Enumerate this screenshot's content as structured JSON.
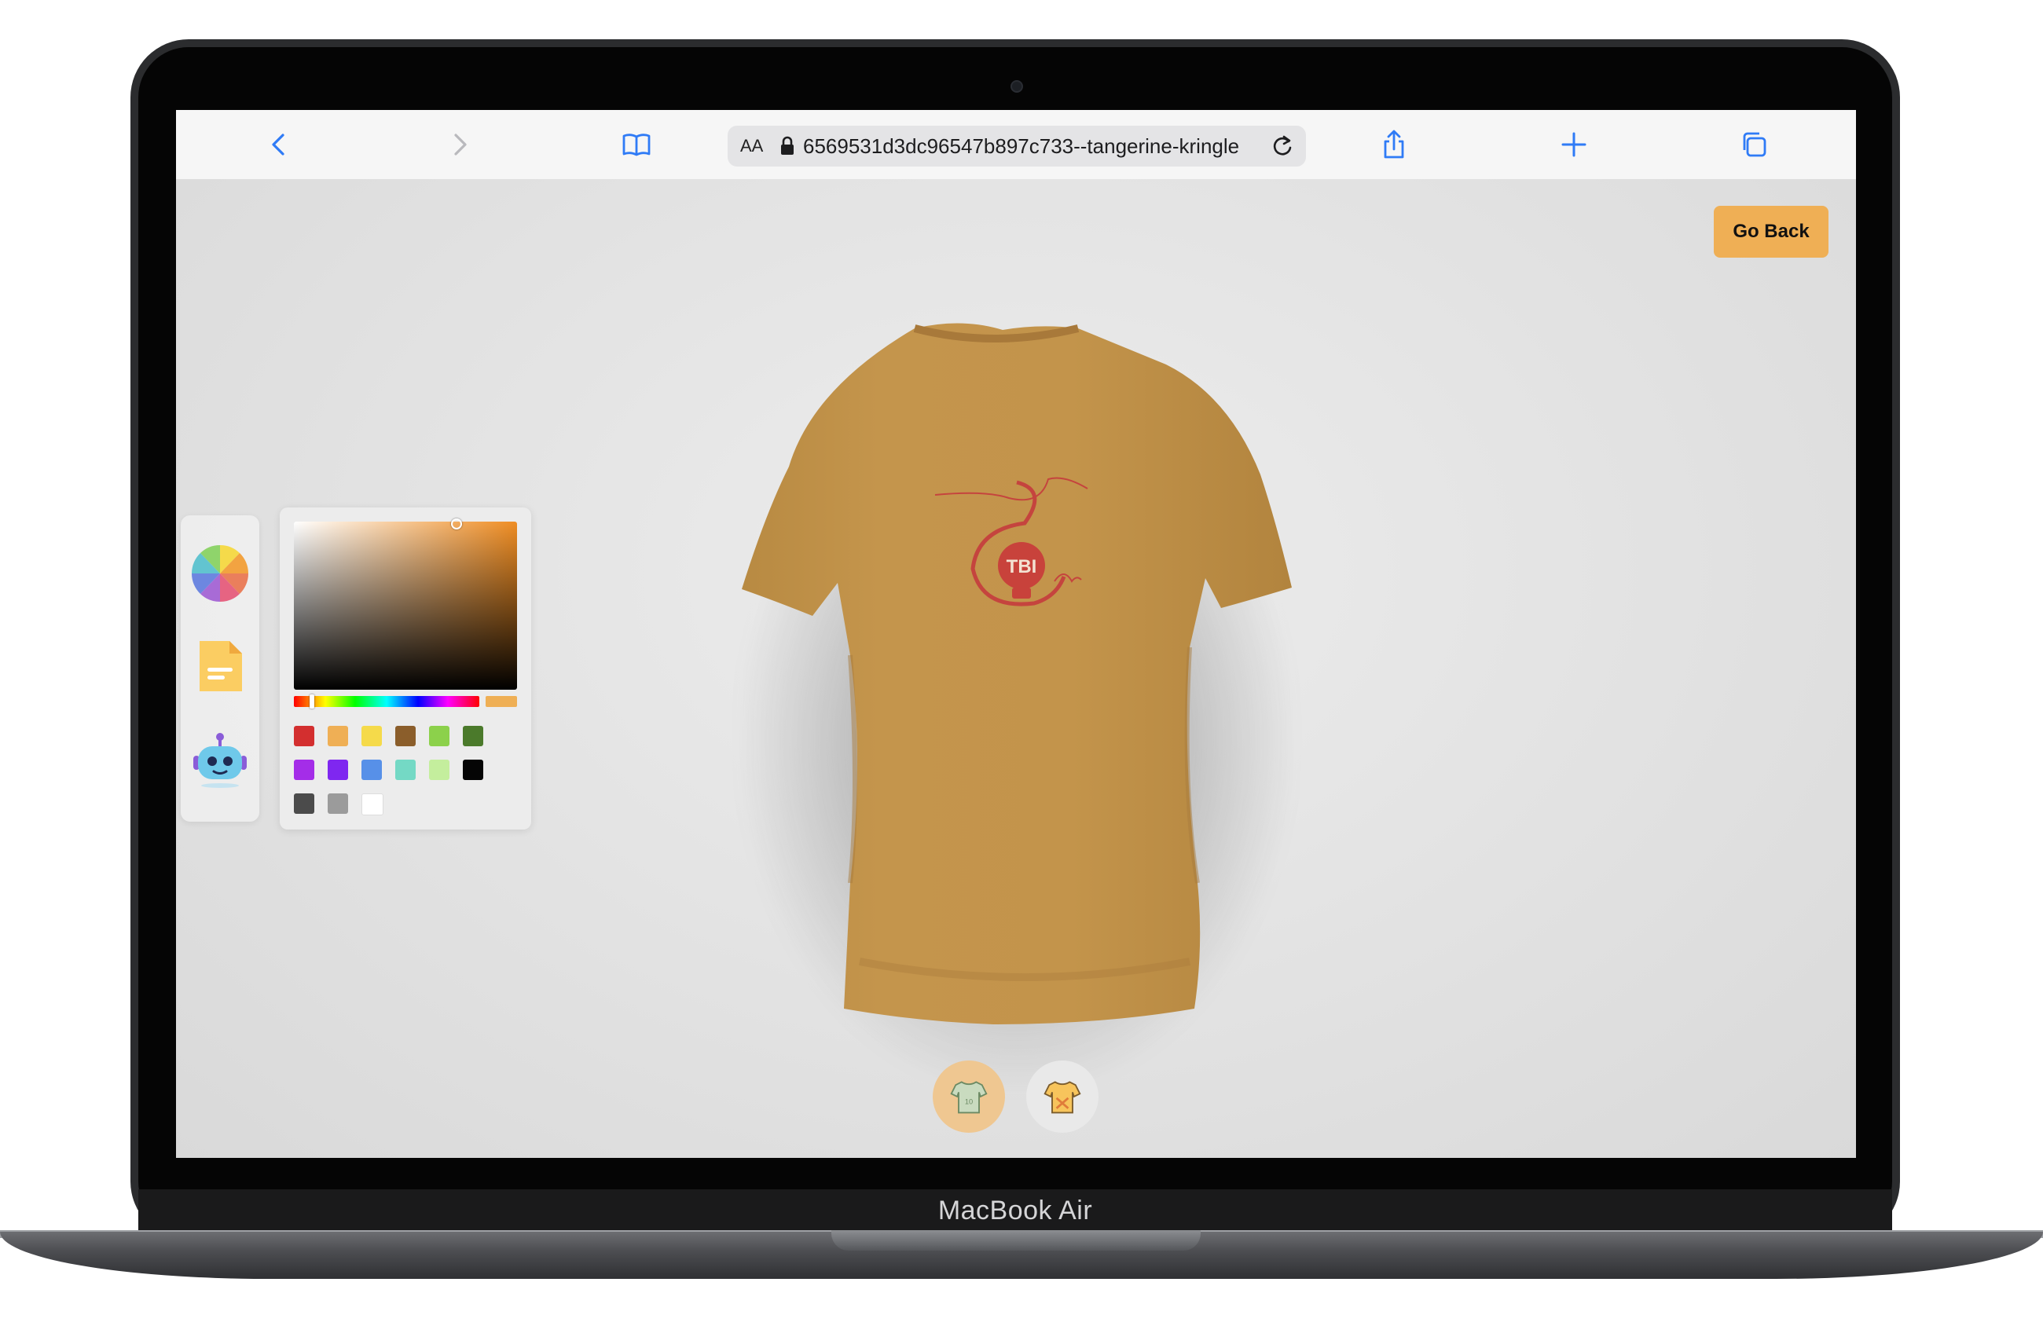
{
  "device": {
    "model_label": "MacBook Air"
  },
  "browser": {
    "text_size_label": "AA",
    "url": "6569531d3dc96547b897c733--tangerine-kringle",
    "icons": [
      "back-icon",
      "forward-icon",
      "bookmarks-icon",
      "lock-icon",
      "reload-icon",
      "share-icon",
      "new-tab-icon",
      "tabs-icon"
    ]
  },
  "app": {
    "go_back_label": "Go Back",
    "accent_color": "#efaf55",
    "shirt_color": "#c1924a",
    "logo_text": "TBI",
    "editor_tabs": [
      "colorpicker-icon",
      "file-picker-icon",
      "ai-picker-icon"
    ],
    "filter_tabs": [
      "logo-shirt-icon",
      "stylish-shirt-icon"
    ],
    "color_picker": {
      "current_color": "#efaf55",
      "swatches": [
        "#d32f2f",
        "#efaf55",
        "#f5da4a",
        "#8b5e2b",
        "#8cd14b",
        "#4b7a2b",
        "#a42de8",
        "#7f27f0",
        "#5790e8",
        "#74d9c5",
        "#c4ee9d",
        "#050505",
        "#4b4b4b",
        "#9b9b9b",
        "#ffffff"
      ]
    }
  }
}
